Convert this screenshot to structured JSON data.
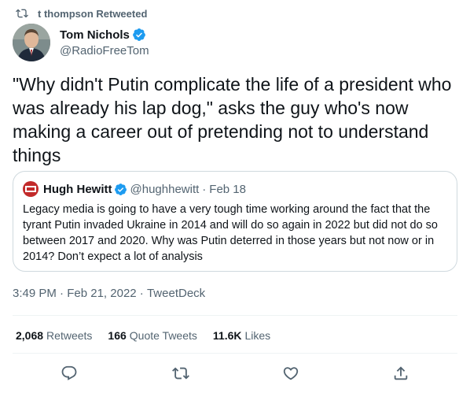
{
  "retweet_context": {
    "text": "t thompson Retweeted",
    "icon": "retweet-icon"
  },
  "author": {
    "name": "Tom Nichols",
    "handle": "@RadioFreeTom",
    "verified": true
  },
  "tweet": {
    "text": "\"Why didn't Putin complicate the life of a president who was already his lap dog,\" asks the guy who's now making a career out of pretending not to understand things"
  },
  "quote": {
    "name": "Hugh Hewitt",
    "handle": "@hughhewitt",
    "separator": "·",
    "date": "Feb 18",
    "verified": true,
    "text": "Legacy media is going to have a very tough time working around the fact that the tyrant Putin invaded Ukraine in 2014 and will do so again in 2022 but did not do so between 2017 and 2020. Why was Putin deterred in those years but not now or in 2014? Don’t expect a lot of analysis"
  },
  "meta": {
    "time": "3:49 PM",
    "sep1": " · ",
    "date": "Feb 21, 2022",
    "sep2": " · ",
    "client": "TweetDeck"
  },
  "stats": {
    "retweets": {
      "count": "2,068",
      "label": "Retweets"
    },
    "quotes": {
      "count": "166",
      "label": "Quote Tweets"
    },
    "likes": {
      "count": "11.6K",
      "label": "Likes"
    }
  },
  "actions": [
    "reply-icon",
    "retweet-icon",
    "like-icon",
    "share-icon"
  ],
  "colors": {
    "text": "#0f1419",
    "secondary": "#536471",
    "border": "#cfd9de",
    "verified": "#1d9bf0"
  }
}
